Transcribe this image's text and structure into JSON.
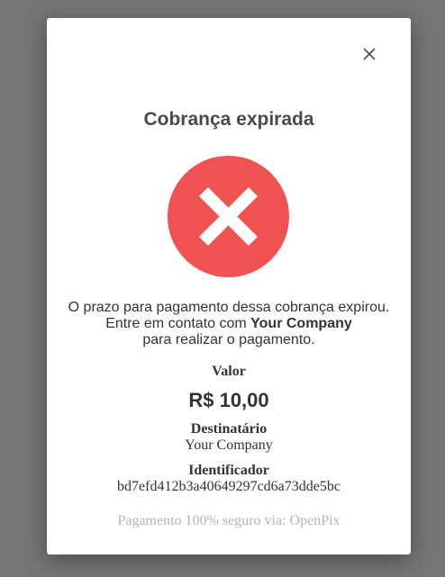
{
  "modal": {
    "title": "Cobrança expirada",
    "close_icon": "close-icon",
    "status_icon": "error-x-circle-icon",
    "message": {
      "line1": "O prazo para pagamento dessa cobrança expirou.",
      "line2_prefix": "Entre em contato com ",
      "company": "Your Company",
      "line3": "para realizar o pagamento."
    },
    "value_label": "Valor",
    "value": "R$ 10,00",
    "recipient_label": "Destinatário",
    "recipient": "Your Company",
    "identifier_label": "Identificador",
    "identifier": "bd7efd412b3a40649297cd6a73dde5bc",
    "footer_prefix": "Pagamento 100% seguro via: ",
    "footer_brand": "OpenPix"
  },
  "colors": {
    "overlay": "#757575",
    "modal_background": "#ffffff",
    "error_red": "#f05252",
    "text": "#333333",
    "title_text": "#4a4a4a",
    "muted_text": "#b5b5b5"
  }
}
